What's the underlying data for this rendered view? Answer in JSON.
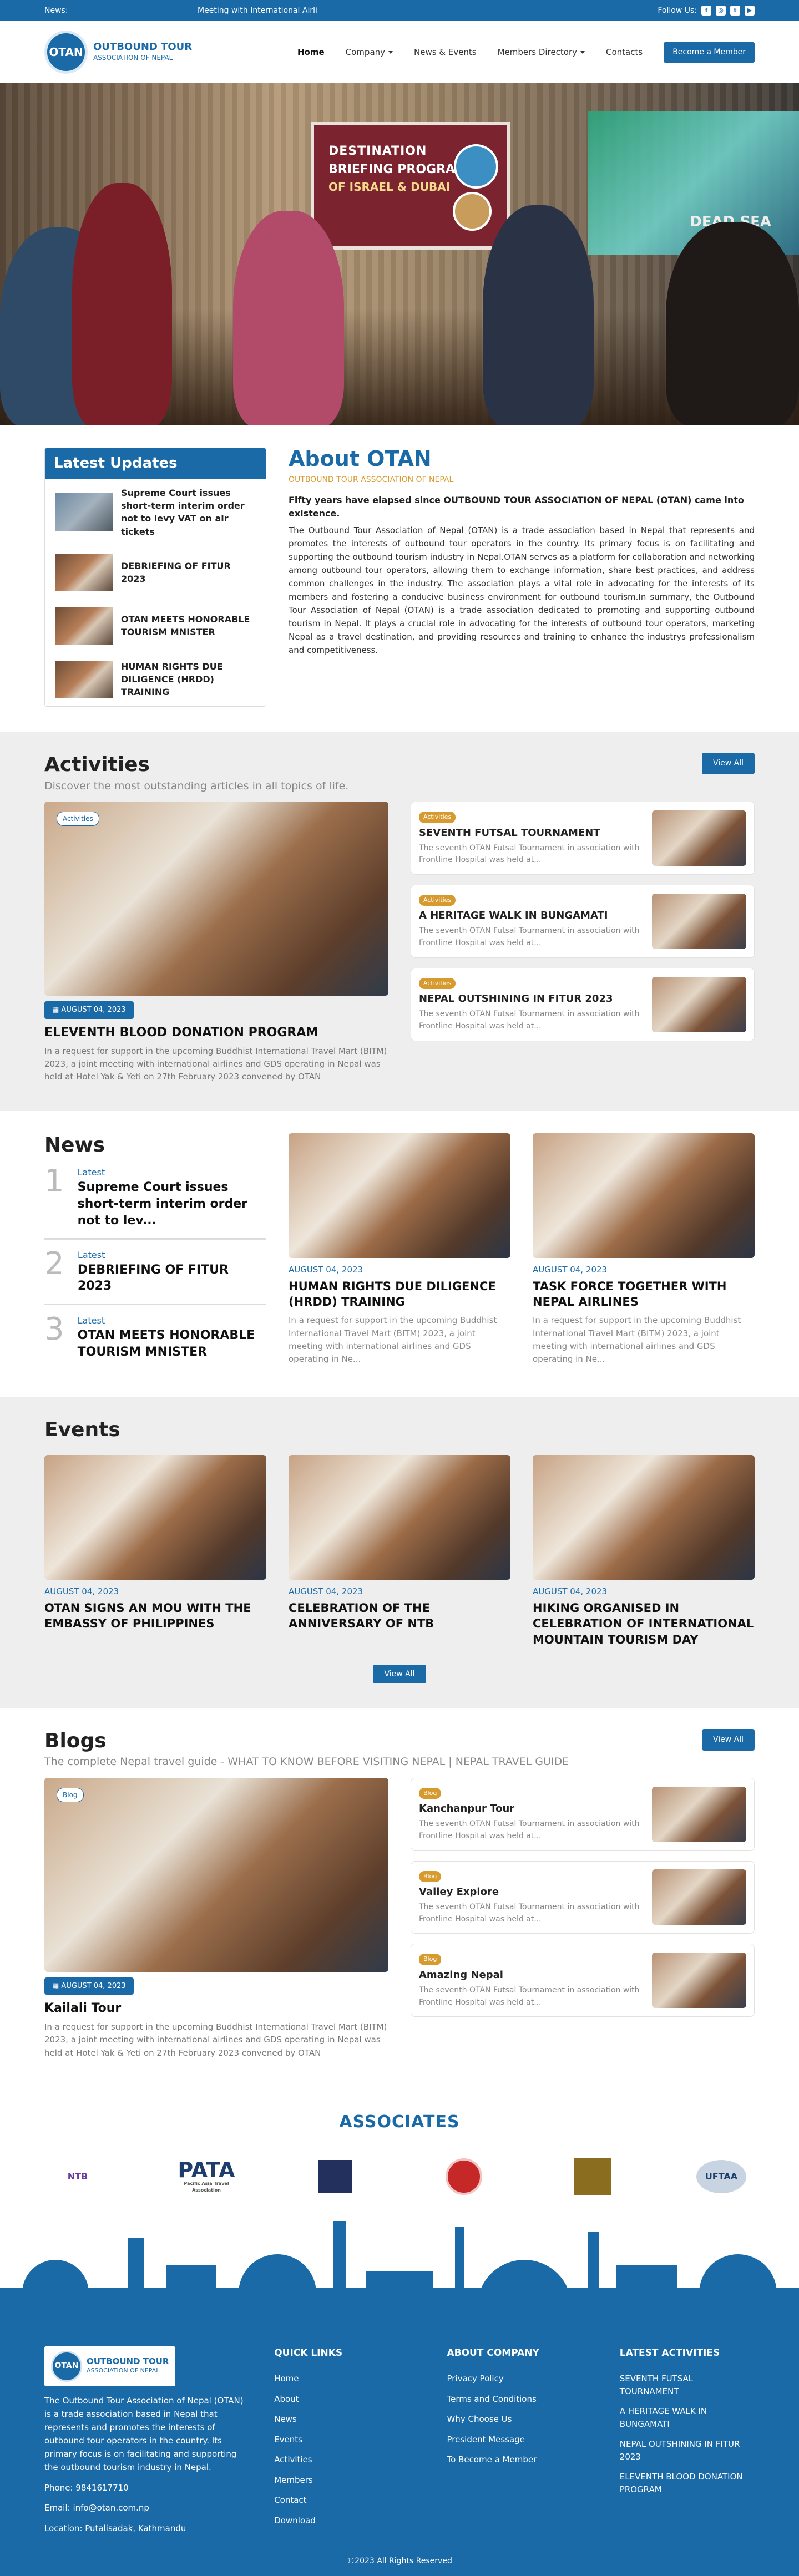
{
  "topbar": {
    "news_label": "News:",
    "ticker": "Meeting with International Airli",
    "follow": "Follow Us:",
    "socials": [
      "facebook-icon",
      "instagram-icon",
      "twitter-icon",
      "youtube-icon"
    ]
  },
  "header": {
    "logo_mark": "OTAN",
    "logo_line1": "OUTBOUND TOUR",
    "logo_line2": "ASSOCIATION OF NEPAL",
    "nav": [
      "Home",
      "Company",
      "News & Events",
      "Members Directory",
      "Contacts"
    ],
    "cta": "Become a Member"
  },
  "hero": {
    "banner_l1": "DESTINATION",
    "banner_l2": "BRIEFING PROGRAM",
    "banner_l3": "OF ISRAEL & DUBAI",
    "screen_text": "DEAD SEA"
  },
  "latest": {
    "title": "Latest Updates",
    "items": [
      "Supreme Court issues short-term interim order not to levy VAT on air tickets",
      "DEBRIEFING OF FITUR 2023",
      "OTAN MEETS HONORABLE TOURISM MNISTER",
      "HUMAN RIGHTS DUE DILIGENCE (HRDD) TRAINING"
    ]
  },
  "about": {
    "title": "About OTAN",
    "subtitle": "OUTBOUND TOUR ASSOCIATION OF NEPAL",
    "lead": "Fifty years have elapsed since OUTBOUND TOUR ASSOCIATION OF NEPAL (OTAN) came into existence.",
    "body": "The Outbound Tour Association of Nepal (OTAN) is a trade association based in Nepal that represents and promotes the interests of outbound tour operators in the country. Its primary focus is on facilitating and supporting the outbound tourism industry in Nepal.OTAN serves as a platform for collaboration and networking among outbound tour operators, allowing them to exchange information, share best practices, and address common challenges in the industry. The association plays a vital role in advocating for the interests of its members and fostering a conducive business environment for outbound tourism.In summary, the Outbound Tour Association of Nepal (OTAN) is a trade association dedicated to promoting and supporting outbound tourism in Nepal. It plays a crucial role in advocating for the interests of outbound tour operators, marketing Nepal as a travel destination, and providing resources and training to enhance the industrys professionalism and competitiveness."
  },
  "activities": {
    "title": "Activities",
    "subtitle": "Discover the most outstanding articles in all topics of life.",
    "view_all": "View All",
    "featured": {
      "tag": "Activities",
      "date": "AUGUST 04, 2023",
      "title": "ELEVENTH BLOOD DONATION PROGRAM",
      "desc": "In a request for support in the upcoming Buddhist International Travel Mart (BITM) 2023, a joint meeting with international airlines and GDS operating in Nepal was held at Hotel Yak & Yeti on 27th February 2023 convened by OTAN"
    },
    "items": [
      {
        "badge": "Activities",
        "title": "SEVENTH FUTSAL TOURNAMENT",
        "desc": "The seventh OTAN Futsal Tournament in association with Frontline Hospital was held at..."
      },
      {
        "badge": "Activities",
        "title": "A HERITAGE WALK IN BUNGAMATI",
        "desc": "The seventh OTAN Futsal Tournament in association with Frontline Hospital was held at..."
      },
      {
        "badge": "Activities",
        "title": "NEPAL OUTSHINING IN FITUR 2023",
        "desc": "The seventh OTAN Futsal Tournament in association with Frontline Hospital was held at..."
      }
    ]
  },
  "news": {
    "title": "News",
    "list": [
      {
        "num": "1",
        "small": "Latest",
        "title": "Supreme Court issues short-term interim order not to lev..."
      },
      {
        "num": "2",
        "small": "Latest",
        "title": "DEBRIEFING OF FITUR 2023"
      },
      {
        "num": "3",
        "small": "Latest",
        "title": "OTAN MEETS HONORABLE TOURISM MNISTER"
      }
    ],
    "cards": [
      {
        "date": "AUGUST 04, 2023",
        "title": "HUMAN RIGHTS DUE DILIGENCE (HRDD) TRAINING",
        "desc": "In a request for support in the upcoming Buddhist International Travel Mart (BITM) 2023, a joint meeting with international airlines and GDS operating in Ne..."
      },
      {
        "date": "AUGUST 04, 2023",
        "title": "TASK FORCE TOGETHER WITH NEPAL AIRLINES",
        "desc": "In a request for support in the upcoming Buddhist International Travel Mart (BITM) 2023, a joint meeting with international airlines and GDS operating in Ne..."
      }
    ]
  },
  "events": {
    "title": "Events",
    "view_all": "View All",
    "items": [
      {
        "date": "AUGUST 04, 2023",
        "title": "OTAN SIGNS AN MOU WITH THE EMBASSY OF PHILIPPINES"
      },
      {
        "date": "AUGUST 04, 2023",
        "title": "CELEBRATION OF THE ANNIVERSARY OF NTB"
      },
      {
        "date": "AUGUST 04, 2023",
        "title": "HIKING ORGANISED IN CELEBRATION OF INTERNATIONAL MOUNTAIN TOURISM DAY"
      }
    ]
  },
  "blogs": {
    "title": "Blogs",
    "subtitle": "The complete Nepal travel guide - WHAT TO KNOW BEFORE VISITING NEPAL | NEPAL TRAVEL GUIDE",
    "view_all": "View All",
    "featured": {
      "tag": "Blog",
      "date": "AUGUST 04, 2023",
      "title": "Kailali Tour",
      "desc": "In a request for support in the upcoming Buddhist International Travel Mart (BITM) 2023, a joint meeting with international airlines and GDS operating in Nepal was held at Hotel Yak & Yeti on 27th February 2023 convened by OTAN"
    },
    "items": [
      {
        "badge": "Blog",
        "title": "Kanchanpur Tour",
        "desc": "The seventh OTAN Futsal Tournament in association with Frontline Hospital was held at..."
      },
      {
        "badge": "Blog",
        "title": "Valley Explore",
        "desc": "The seventh OTAN Futsal Tournament in association with Frontline Hospital was held at..."
      },
      {
        "badge": "Blog",
        "title": "Amazing Nepal",
        "desc": "The seventh OTAN Futsal Tournament in association with Frontline Hospital was held at..."
      }
    ]
  },
  "associates": {
    "title": "ASSOCIATES",
    "logos": [
      "NTB",
      "PATA",
      "",
      "",
      "",
      ""
    ],
    "pata_sub": "Pacific Asia Travel Association",
    "uftaa": "UFTAA"
  },
  "footer": {
    "logo_mark": "OTAN",
    "logo_line1": "OUTBOUND TOUR",
    "logo_line2": "ASSOCIATION OF NEPAL",
    "about": "The Outbound Tour Association of Nepal (OTAN) is a trade association based in Nepal that represents and promotes the interests of outbound tour operators in the country. Its primary focus is on facilitating and supporting the outbound tourism industry in Nepal.",
    "phone": "Phone: 9841617710",
    "email": "Email: info@otan.com.np",
    "location": "Location: Putalisadak, Kathmandu",
    "quick_head": "QUICK LINKS",
    "quick": [
      "Home",
      "About",
      "News",
      "Events",
      "Activities",
      "Members",
      "Contact",
      "Download"
    ],
    "company_head": "ABOUT COMPANY",
    "company": [
      "Privacy Policy",
      "Terms and Conditions",
      "Why Choose Us",
      "President Message",
      "To Become a Member"
    ],
    "activities_head": "LATEST ACTIVITIES",
    "activities": [
      "SEVENTH FUTSAL TOURNAMENT",
      "A HERITAGE WALK IN BUNGAMATI",
      "NEPAL OUTSHINING IN FITUR 2023",
      "ELEVENTH BLOOD DONATION PROGRAM"
    ],
    "copyright": "©2023 All Rights Reserved"
  },
  "colors": {
    "primary": "#1a6aa7",
    "accent": "#d69a2e",
    "section_gray": "#eeeeee"
  }
}
